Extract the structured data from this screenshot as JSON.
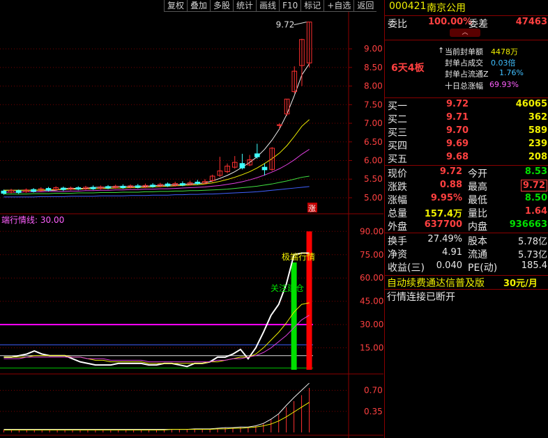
{
  "toolbar": {
    "buttons": [
      "复权",
      "叠加",
      "多股",
      "统计",
      "画线",
      "F10",
      "标记",
      "+自选",
      "返回"
    ]
  },
  "chart": {
    "price_axis": [
      "9.00",
      "8.50",
      "8.00",
      "7.50",
      "7.00",
      "6.50",
      "6.00",
      "5.50",
      "5.00"
    ],
    "high_label": "9.72",
    "limit_badge": "涨",
    "indicator_title": "端行情线: 30.00",
    "indicator_axis": [
      "90.00",
      "75.00",
      "60.00",
      "45.00",
      "30.00",
      "15.00"
    ],
    "label_extreme": "极端行情",
    "label_green": "关注建仓",
    "volume_axis": [
      "0.70",
      "0.35"
    ]
  },
  "chart_data": [
    {
      "type": "candlestick",
      "ylim": [
        4.7,
        9.9
      ],
      "y_ticks": [
        5.0,
        5.5,
        6.0,
        6.5,
        7.0,
        7.5,
        8.0,
        8.5,
        9.0
      ],
      "annotation": "9.72",
      "candles": [
        {
          "o": 5.18,
          "c": 5.12,
          "h": 5.22,
          "l": 5.08
        },
        {
          "o": 5.15,
          "c": 5.2,
          "h": 5.24,
          "l": 5.12
        },
        {
          "o": 5.19,
          "c": 5.14,
          "h": 5.22,
          "l": 5.1
        },
        {
          "o": 5.16,
          "c": 5.21,
          "h": 5.25,
          "l": 5.13
        },
        {
          "o": 5.22,
          "c": 5.17,
          "h": 5.26,
          "l": 5.14
        },
        {
          "o": 5.19,
          "c": 5.24,
          "h": 5.28,
          "l": 5.16
        },
        {
          "o": 5.25,
          "c": 5.2,
          "h": 5.29,
          "l": 5.17
        },
        {
          "o": 5.22,
          "c": 5.27,
          "h": 5.31,
          "l": 5.19
        },
        {
          "o": 5.26,
          "c": 5.22,
          "h": 5.3,
          "l": 5.18
        },
        {
          "o": 5.23,
          "c": 5.26,
          "h": 5.3,
          "l": 5.2
        },
        {
          "o": 5.27,
          "c": 5.23,
          "h": 5.31,
          "l": 5.2
        },
        {
          "o": 5.24,
          "c": 5.28,
          "h": 5.32,
          "l": 5.21
        },
        {
          "o": 5.28,
          "c": 5.24,
          "h": 5.33,
          "l": 5.21
        },
        {
          "o": 5.25,
          "c": 5.29,
          "h": 5.33,
          "l": 5.22
        },
        {
          "o": 5.3,
          "c": 5.26,
          "h": 5.34,
          "l": 5.23
        },
        {
          "o": 5.27,
          "c": 5.31,
          "h": 5.35,
          "l": 5.24
        },
        {
          "o": 5.31,
          "c": 5.27,
          "h": 5.36,
          "l": 5.24
        },
        {
          "o": 5.28,
          "c": 5.32,
          "h": 5.36,
          "l": 5.25
        },
        {
          "o": 5.32,
          "c": 5.28,
          "h": 5.37,
          "l": 5.25
        },
        {
          "o": 5.29,
          "c": 5.33,
          "h": 5.38,
          "l": 5.26
        },
        {
          "o": 5.34,
          "c": 5.3,
          "h": 5.39,
          "l": 5.27
        },
        {
          "o": 5.31,
          "c": 5.36,
          "h": 5.4,
          "l": 5.28
        },
        {
          "o": 5.37,
          "c": 5.32,
          "h": 5.41,
          "l": 5.29
        },
        {
          "o": 5.33,
          "c": 5.38,
          "h": 5.43,
          "l": 5.3
        },
        {
          "o": 5.38,
          "c": 5.34,
          "h": 5.44,
          "l": 5.31
        },
        {
          "o": 5.35,
          "c": 5.4,
          "h": 5.46,
          "l": 5.33
        },
        {
          "o": 5.42,
          "c": 5.38,
          "h": 5.48,
          "l": 5.35
        },
        {
          "o": 5.39,
          "c": 5.44,
          "h": 5.5,
          "l": 5.37
        },
        {
          "o": 5.46,
          "c": 5.58,
          "h": 5.62,
          "l": 5.42
        },
        {
          "o": 5.6,
          "c": 5.72,
          "h": 6.1,
          "l": 5.56
        },
        {
          "o": 5.7,
          "c": 5.85,
          "h": 5.92,
          "l": 5.66
        },
        {
          "o": 5.82,
          "c": 5.95,
          "h": 6.12,
          "l": 5.78
        },
        {
          "o": 5.92,
          "c": 5.8,
          "h": 6.18,
          "l": 5.76
        },
        {
          "o": 5.88,
          "c": 6.02,
          "h": 6.15,
          "l": 5.85
        },
        {
          "o": 6.18,
          "c": 6.1,
          "h": 6.45,
          "l": 6.05
        },
        {
          "o": 5.82,
          "c": 5.75,
          "h": 5.92,
          "l": 5.6
        },
        {
          "o": 5.76,
          "c": 6.33,
          "h": 6.36,
          "l": 5.72
        },
        {
          "o": 6.95,
          "c": 6.96,
          "h": 7.0,
          "l": 6.85
        },
        {
          "o": 7.25,
          "c": 7.65,
          "h": 7.65,
          "l": 7.2
        },
        {
          "o": 7.85,
          "c": 8.4,
          "h": 8.53,
          "l": 7.8
        },
        {
          "o": 8.55,
          "c": 9.25,
          "h": 9.27,
          "l": 8.0
        },
        {
          "o": 8.62,
          "c": 9.72,
          "h": 9.72,
          "l": 8.5
        }
      ],
      "moving_averages": [
        {
          "color": "#f0f0f0",
          "values": [
            5.2,
            5.2,
            5.2,
            5.2,
            5.2,
            5.2,
            5.2,
            5.2,
            5.25,
            5.25,
            5.25,
            5.25,
            5.28,
            5.28,
            5.28,
            5.3,
            5.3,
            5.3,
            5.31,
            5.31,
            5.32,
            5.33,
            5.34,
            5.35,
            5.36,
            5.37,
            5.38,
            5.4,
            5.45,
            5.52,
            5.6,
            5.7,
            5.82,
            5.95,
            6.1,
            6.3,
            6.55,
            6.85,
            7.25,
            7.75,
            8.3,
            8.6
          ]
        },
        {
          "color": "#f0f000",
          "values": [
            5.2,
            5.2,
            5.2,
            5.2,
            5.2,
            5.21,
            5.21,
            5.22,
            5.22,
            5.23,
            5.23,
            5.24,
            5.24,
            5.25,
            5.25,
            5.26,
            5.26,
            5.27,
            5.27,
            5.28,
            5.29,
            5.3,
            5.31,
            5.32,
            5.33,
            5.34,
            5.35,
            5.37,
            5.4,
            5.44,
            5.49,
            5.55,
            5.62,
            5.7,
            5.8,
            5.92,
            6.05,
            6.2,
            6.4,
            6.65,
            6.92,
            7.1
          ]
        },
        {
          "color": "#e040e0",
          "values": [
            5.15,
            5.15,
            5.15,
            5.16,
            5.16,
            5.16,
            5.17,
            5.17,
            5.17,
            5.18,
            5.18,
            5.19,
            5.19,
            5.2,
            5.2,
            5.21,
            5.21,
            5.22,
            5.22,
            5.23,
            5.23,
            5.24,
            5.24,
            5.25,
            5.26,
            5.27,
            5.28,
            5.29,
            5.31,
            5.33,
            5.36,
            5.39,
            5.43,
            5.48,
            5.54,
            5.61,
            5.69,
            5.78,
            5.89,
            6.02,
            6.17,
            6.3
          ]
        },
        {
          "color": "#40e040",
          "values": [
            5.1,
            5.1,
            5.1,
            5.1,
            5.11,
            5.11,
            5.11,
            5.12,
            5.12,
            5.12,
            5.13,
            5.13,
            5.13,
            5.14,
            5.14,
            5.14,
            5.15,
            5.15,
            5.15,
            5.16,
            5.16,
            5.17,
            5.17,
            5.18,
            5.18,
            5.19,
            5.19,
            5.2,
            5.21,
            5.22,
            5.23,
            5.25,
            5.27,
            5.29,
            5.31,
            5.34,
            5.37,
            5.41,
            5.45,
            5.5,
            5.55,
            5.58
          ]
        },
        {
          "color": "#4060ff",
          "values": [
            5.02,
            5.02,
            5.02,
            5.02,
            5.02,
            5.03,
            5.03,
            5.03,
            5.03,
            5.04,
            5.04,
            5.04,
            5.04,
            5.05,
            5.05,
            5.05,
            5.05,
            5.06,
            5.06,
            5.06,
            5.07,
            5.07,
            5.07,
            5.08,
            5.08,
            5.09,
            5.09,
            5.1,
            5.1,
            5.11,
            5.12,
            5.13,
            5.14,
            5.15,
            5.16,
            5.18,
            5.2,
            5.22,
            5.24,
            5.26,
            5.28,
            5.3
          ]
        }
      ]
    },
    {
      "type": "line",
      "ylim": [
        0,
        100
      ],
      "y_ticks": [
        15,
        30,
        45,
        60,
        75,
        90
      ],
      "threshold": 30,
      "levels": [
        2,
        10,
        17
      ],
      "bars": [
        {
          "index": 38,
          "value": 70,
          "color": "#00e000"
        },
        {
          "index": 40,
          "value": 90,
          "color": "#ff0000"
        }
      ],
      "series": [
        {
          "color": "#ffffff",
          "values": [
            9,
            9,
            10,
            11,
            13,
            11,
            10,
            10,
            10,
            8,
            6,
            5,
            4,
            4,
            4,
            5,
            5,
            5,
            5,
            4,
            4,
            5,
            5,
            4,
            3,
            5,
            5,
            6,
            9,
            9,
            11,
            14,
            8,
            15,
            25,
            36,
            43,
            56,
            75,
            76,
            76
          ]
        },
        {
          "color": "#f0f000",
          "values": [
            9,
            9,
            9,
            9,
            10,
            10,
            10,
            10,
            10,
            9,
            9,
            8,
            7,
            7,
            6,
            6,
            6,
            6,
            6,
            5,
            5,
            5,
            5,
            5,
            5,
            5,
            5,
            6,
            6,
            7,
            8,
            9,
            9,
            11,
            15,
            20,
            25,
            31,
            38,
            43,
            44
          ]
        },
        {
          "color": "#e040e0",
          "values": [
            8,
            8,
            8,
            9,
            9,
            9,
            9,
            9,
            9,
            9,
            9,
            8,
            8,
            8,
            7,
            7,
            7,
            7,
            7,
            6,
            6,
            6,
            6,
            6,
            6,
            6,
            6,
            6,
            7,
            7,
            8,
            8,
            9,
            10,
            12,
            15,
            19,
            23,
            28,
            33,
            36
          ]
        }
      ]
    },
    {
      "type": "bar",
      "ylim": [
        0,
        0.88
      ],
      "y_ticks": [
        0.35,
        0.7
      ],
      "values": [
        0.04,
        0.04,
        0.04,
        0.04,
        0.04,
        0.04,
        0.04,
        0.04,
        0.04,
        0.05,
        0.05,
        0.05,
        0.05,
        0.05,
        0.05,
        0.05,
        0.05,
        0.05,
        0.05,
        0.05,
        0.05,
        0.05,
        0.05,
        0.05,
        0.05,
        0.06,
        0.06,
        0.06,
        0.07,
        0.08,
        0.08,
        0.09,
        0.08,
        0.11,
        0.15,
        0.22,
        0.3,
        0.42,
        0.52,
        0.62,
        0.74
      ],
      "lines": [
        {
          "color": "#f0f0f0",
          "values": [
            0.05,
            0.05,
            0.05,
            0.05,
            0.05,
            0.05,
            0.05,
            0.05,
            0.05,
            0.05,
            0.05,
            0.05,
            0.05,
            0.05,
            0.05,
            0.05,
            0.05,
            0.05,
            0.05,
            0.05,
            0.05,
            0.05,
            0.05,
            0.05,
            0.05,
            0.06,
            0.06,
            0.06,
            0.07,
            0.08,
            0.08,
            0.09,
            0.09,
            0.11,
            0.15,
            0.22,
            0.31,
            0.45,
            0.58,
            0.7,
            0.82
          ]
        },
        {
          "color": "#f0f000",
          "values": [
            0.04,
            0.04,
            0.04,
            0.04,
            0.04,
            0.04,
            0.04,
            0.04,
            0.04,
            0.04,
            0.04,
            0.04,
            0.04,
            0.04,
            0.04,
            0.04,
            0.04,
            0.04,
            0.04,
            0.04,
            0.04,
            0.04,
            0.05,
            0.05,
            0.05,
            0.05,
            0.05,
            0.05,
            0.06,
            0.06,
            0.07,
            0.07,
            0.08,
            0.09,
            0.11,
            0.14,
            0.19,
            0.26,
            0.34,
            0.42,
            0.5
          ]
        }
      ]
    }
  ],
  "quote": {
    "code": "000421",
    "name": "南京公用",
    "weibi_label": "委比",
    "weibi_value": "100.00%",
    "weicha_label": "委差",
    "weicha_value": "47463",
    "board_label": "6天4板",
    "seal_amount_label": "当前封单额",
    "seal_amount_value": "4478万",
    "seal_ratio_label": "封单占成交",
    "seal_ratio_value": "0.03倍",
    "seal_float_label": "封单占流通Z",
    "seal_float_value": "1.76%",
    "ten_day_label": "十日总涨幅",
    "ten_day_value": "69.93%",
    "bids": [
      {
        "label": "买一",
        "price": "9.72",
        "vol": "46065"
      },
      {
        "label": "买二",
        "price": "9.71",
        "vol": "362"
      },
      {
        "label": "买三",
        "price": "9.70",
        "vol": "589"
      },
      {
        "label": "买四",
        "price": "9.69",
        "vol": "239"
      },
      {
        "label": "买五",
        "price": "9.68",
        "vol": "208"
      }
    ],
    "stats": [
      {
        "l1": "现价",
        "v1": "9.72",
        "l2": "今开",
        "v2": "8.53",
        "c1": "red",
        "c2": "green"
      },
      {
        "l1": "涨跌",
        "v1": "0.88",
        "l2": "最高",
        "v2": "9.72",
        "c1": "red",
        "c2": "red"
      },
      {
        "l1": "涨幅",
        "v1": "9.95%",
        "l2": "最低",
        "v2": "8.50",
        "c1": "red",
        "c2": "green"
      },
      {
        "l1": "总量",
        "v1": "157.4万",
        "l2": "量比",
        "v2": "1.64",
        "c1": "yellow",
        "c2": "red"
      },
      {
        "l1": "外盘",
        "v1": "637700",
        "l2": "内盘",
        "v2": "936663",
        "c1": "red",
        "c2": "green"
      }
    ],
    "more": [
      {
        "l1": "换手",
        "v1": "27.49%",
        "l2": "股本",
        "v2": "5.78亿"
      },
      {
        "l1": "净资",
        "v1": "4.91",
        "l2": "流通",
        "v2": "5.73亿"
      },
      {
        "l1": "收益(三)",
        "v1": "0.040",
        "l2": "PE(动)",
        "v2": "185.4"
      }
    ],
    "ad_text": "自动续费通达信普及版",
    "ad_price": "30元/月",
    "conn_status": "行情连接已断开"
  }
}
